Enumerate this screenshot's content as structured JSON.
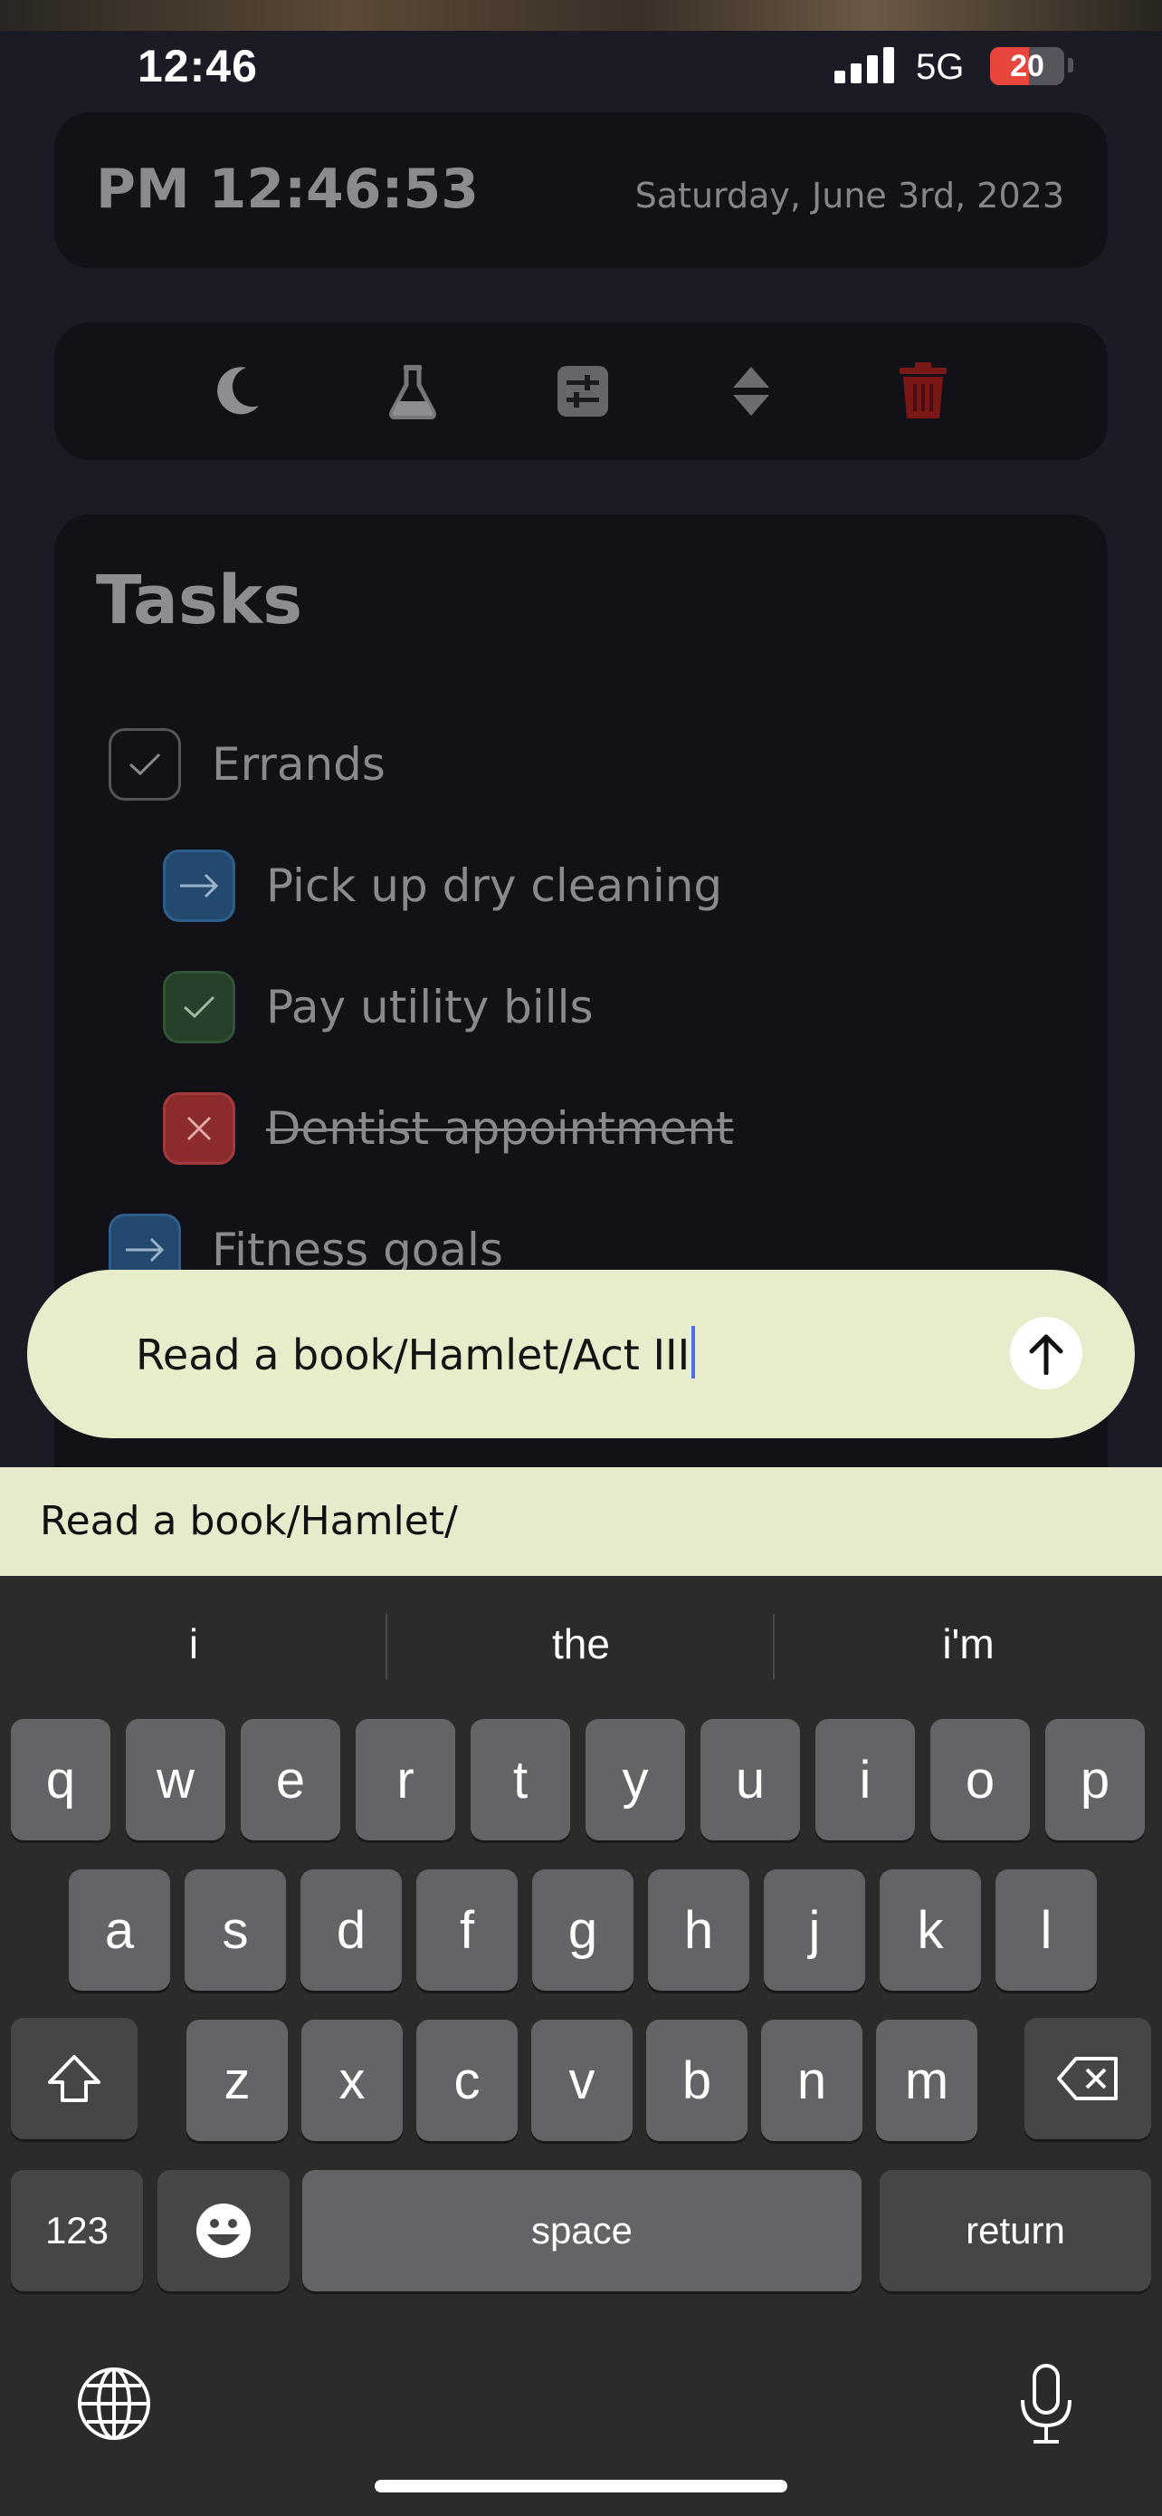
{
  "status_bar": {
    "time": "12:46",
    "network": "5G",
    "battery_level": "20",
    "battery_color": "#e8453c"
  },
  "clock": {
    "time": "PM 12:46:53",
    "date": "Saturday, June 3rd, 2023"
  },
  "toolbar": {
    "icons": [
      "moon-icon",
      "flask-icon",
      "sliders-icon",
      "sort-icon",
      "trash-icon"
    ],
    "danger_color": "#8a1c1c"
  },
  "tasks": {
    "title": "Tasks",
    "items": [
      {
        "label": "Errands",
        "state": "checked",
        "level": 0
      },
      {
        "label": "Pick up dry cleaning",
        "state": "forwarded",
        "level": 1
      },
      {
        "label": "Pay utility bills",
        "state": "done",
        "level": 1
      },
      {
        "label": "Dentist appointment",
        "state": "cancelled",
        "level": 1
      },
      {
        "label": "Fitness goals",
        "state": "forwarded",
        "level": 0
      }
    ]
  },
  "input": {
    "value": "Read a book/Hamlet/Act III",
    "send_icon": "arrow-up-icon"
  },
  "autocomplete": {
    "suggestion": "Read a book/Hamlet/"
  },
  "keyboard": {
    "suggestions": [
      "i",
      "the",
      "i'm"
    ],
    "row1": [
      "q",
      "w",
      "e",
      "r",
      "t",
      "y",
      "u",
      "i",
      "o",
      "p"
    ],
    "row2": [
      "a",
      "s",
      "d",
      "f",
      "g",
      "h",
      "j",
      "k",
      "l"
    ],
    "row3": [
      "z",
      "x",
      "c",
      "v",
      "b",
      "n",
      "m"
    ],
    "numbers_label": "123",
    "space_label": "space",
    "return_label": "return"
  }
}
